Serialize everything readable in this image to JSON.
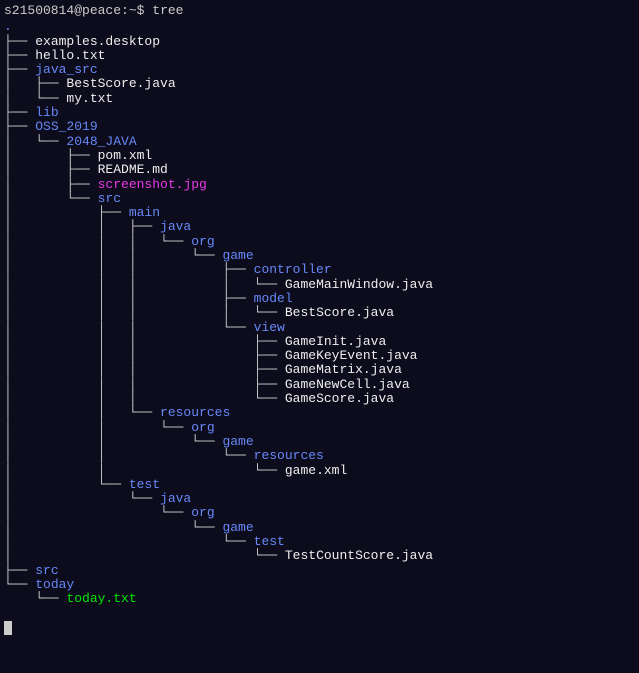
{
  "prompt": {
    "user": "s21500814@peace",
    "separator": ":",
    "path": "~",
    "dollar": "$",
    "command": "tree"
  },
  "root_dot": ".",
  "lines": [
    {
      "prefix": "├── ",
      "text": "examples.desktop",
      "cls": "file-white"
    },
    {
      "prefix": "├── ",
      "text": "hello.txt",
      "cls": "file-white"
    },
    {
      "prefix": "├── ",
      "text": "java_src",
      "cls": "dir-blue"
    },
    {
      "prefix": "│   ├── ",
      "text": "BestScore.java",
      "cls": "file-white"
    },
    {
      "prefix": "│   └── ",
      "text": "my.txt",
      "cls": "file-white"
    },
    {
      "prefix": "├── ",
      "text": "lib",
      "cls": "dir-blue"
    },
    {
      "prefix": "├── ",
      "text": "OSS_2019",
      "cls": "dir-blue"
    },
    {
      "prefix": "│   └── ",
      "text": "2048_JAVA",
      "cls": "dir-blue"
    },
    {
      "prefix": "│       ├── ",
      "text": "pom.xml",
      "cls": "file-white"
    },
    {
      "prefix": "│       ├── ",
      "text": "README.md",
      "cls": "file-white"
    },
    {
      "prefix": "│       ├── ",
      "text": "screenshot.jpg",
      "cls": "file-magenta"
    },
    {
      "prefix": "│       └── ",
      "text": "src",
      "cls": "dir-blue"
    },
    {
      "prefix": "│           ├── ",
      "text": "main",
      "cls": "dir-blue"
    },
    {
      "prefix": "│           │   ├── ",
      "text": "java",
      "cls": "dir-blue"
    },
    {
      "prefix": "│           │   │   └── ",
      "text": "org",
      "cls": "dir-blue"
    },
    {
      "prefix": "│           │   │       └── ",
      "text": "game",
      "cls": "dir-blue"
    },
    {
      "prefix": "│           │   │           ├── ",
      "text": "controller",
      "cls": "dir-blue"
    },
    {
      "prefix": "│           │   │           │   └── ",
      "text": "GameMainWindow.java",
      "cls": "file-white"
    },
    {
      "prefix": "│           │   │           ├── ",
      "text": "model",
      "cls": "dir-blue"
    },
    {
      "prefix": "│           │   │           │   └── ",
      "text": "BestScore.java",
      "cls": "file-white"
    },
    {
      "prefix": "│           │   │           └── ",
      "text": "view",
      "cls": "dir-blue"
    },
    {
      "prefix": "│           │   │               ├── ",
      "text": "GameInit.java",
      "cls": "file-white"
    },
    {
      "prefix": "│           │   │               ├── ",
      "text": "GameKeyEvent.java",
      "cls": "file-white"
    },
    {
      "prefix": "│           │   │               ├── ",
      "text": "GameMatrix.java",
      "cls": "file-white"
    },
    {
      "prefix": "│           │   │               ├── ",
      "text": "GameNewCell.java",
      "cls": "file-white"
    },
    {
      "prefix": "│           │   │               └── ",
      "text": "GameScore.java",
      "cls": "file-white"
    },
    {
      "prefix": "│           │   └── ",
      "text": "resources",
      "cls": "dir-blue"
    },
    {
      "prefix": "│           │       └── ",
      "text": "org",
      "cls": "dir-blue"
    },
    {
      "prefix": "│           │           └── ",
      "text": "game",
      "cls": "dir-blue"
    },
    {
      "prefix": "│           │               └── ",
      "text": "resources",
      "cls": "dir-blue"
    },
    {
      "prefix": "│           │                   └── ",
      "text": "game.xml",
      "cls": "file-white"
    },
    {
      "prefix": "│           └── ",
      "text": "test",
      "cls": "dir-blue"
    },
    {
      "prefix": "│               └── ",
      "text": "java",
      "cls": "dir-blue"
    },
    {
      "prefix": "│                   └── ",
      "text": "org",
      "cls": "dir-blue"
    },
    {
      "prefix": "│                       └── ",
      "text": "game",
      "cls": "dir-blue"
    },
    {
      "prefix": "│                           └── ",
      "text": "test",
      "cls": "dir-blue"
    },
    {
      "prefix": "│                               └── ",
      "text": "TestCountScore.java",
      "cls": "file-white"
    },
    {
      "prefix": "├── ",
      "text": "src",
      "cls": "dir-blue"
    },
    {
      "prefix": "└── ",
      "text": "today",
      "cls": "dir-blue"
    },
    {
      "prefix": "    └── ",
      "text": "today.txt",
      "cls": "file-green"
    }
  ]
}
